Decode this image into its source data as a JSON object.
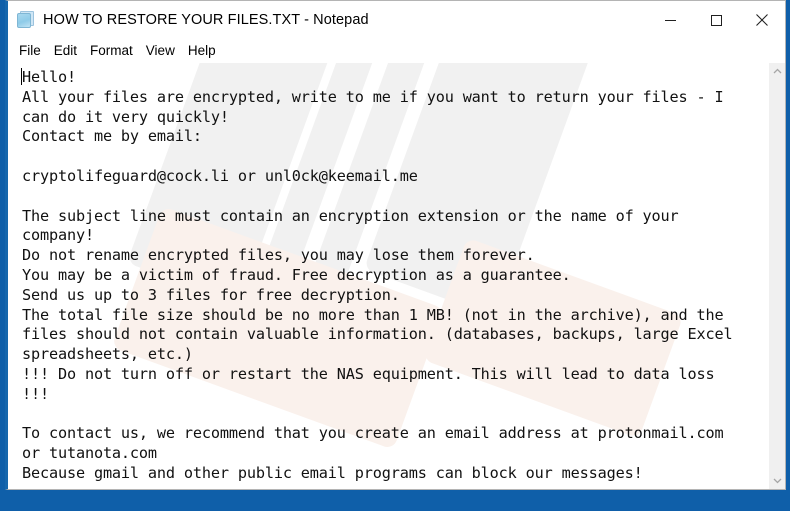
{
  "window": {
    "title": "HOW TO RESTORE YOUR FILES.TXT - Notepad",
    "icon": "notepad-document-icon",
    "controls": {
      "minimize": "Minimize",
      "maximize": "Maximize",
      "close": "Close"
    }
  },
  "menubar": {
    "items": [
      {
        "label": "File"
      },
      {
        "label": "Edit"
      },
      {
        "label": "Format"
      },
      {
        "label": "View"
      },
      {
        "label": "Help"
      }
    ]
  },
  "document": {
    "filename": "HOW TO RESTORE YOUR FILES.TXT",
    "caret_visible": true,
    "contact_emails": [
      "cryptolifeguard@cock.li",
      "unl0ck@keemail.me"
    ],
    "recommended_mail_providers": [
      "protonmail.com",
      "tutanota.com"
    ],
    "max_free_files": 3,
    "max_total_size": "1 MB",
    "lines": [
      "Hello!",
      "All your files are encrypted, write to me if you want to return your files - I",
      "can do it very quickly!",
      "Contact me by email:",
      "",
      "cryptolifeguard@cock.li or unl0ck@keemail.me",
      "",
      "The subject line must contain an encryption extension or the name of your",
      "company!",
      "Do not rename encrypted files, you may lose them forever.",
      "You may be a victim of fraud. Free decryption as a guarantee.",
      "Send us up to 3 files for free decryption.",
      "The total file size should be no more than 1 MB! (not in the archive), and the",
      "files should not contain valuable information. (databases, backups, large Excel",
      "spreadsheets, etc.)",
      "!!! Do not turn off or restart the NAS equipment. This will lead to data loss",
      "!!!",
      "",
      "To contact us, we recommend that you create an email address at protonmail.com",
      "or tutanota.com",
      "Because gmail and other public email programs can block our messages!"
    ],
    "body": "Hello!\nAll your files are encrypted, write to me if you want to return your files - I\ncan do it very quickly!\nContact me by email:\n\ncryptolifeguard@cock.li or unl0ck@keemail.me\n\nThe subject line must contain an encryption extension or the name of your\ncompany!\nDo not rename encrypted files, you may lose them forever.\nYou may be a victim of fraud. Free decryption as a guarantee.\nSend us up to 3 files for free decryption.\nThe total file size should be no more than 1 MB! (not in the archive), and the\nfiles should not contain valuable information. (databases, backups, large Excel\nspreadsheets, etc.)\n!!! Do not turn off or restart the NAS equipment. This will lead to data loss\n!!!\n\nTo contact us, we recommend that you create an email address at protonmail.com\nor tutanota.com\nBecause gmail and other public email programs can block our messages!"
  },
  "scrollbar": {
    "up_arrow": "scroll-up",
    "down_arrow": "scroll-down"
  },
  "colors": {
    "desktop_blue": "#0f5fa9",
    "window_background": "#ffffff",
    "text": "#111111",
    "scrollbar_track": "#f0f0f0",
    "accent_border": "#1667ad"
  }
}
